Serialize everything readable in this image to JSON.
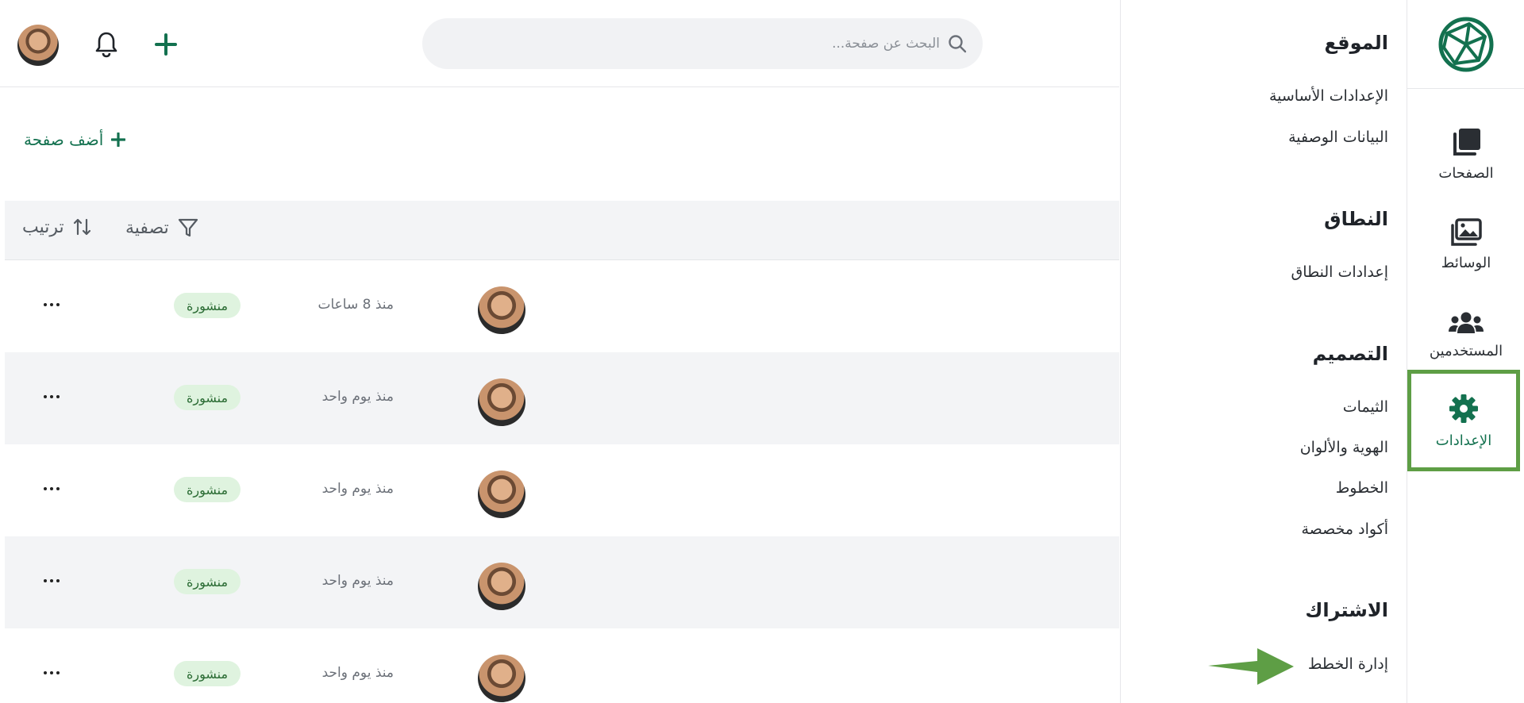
{
  "colors": {
    "brand": "#13714f",
    "active_outline": "#5e9e45",
    "arrow": "#5e9e45",
    "badge_bg": "#dff3df",
    "badge_text": "#2a6b33",
    "row_alt_bg": "#f3f4f6"
  },
  "rail": {
    "logo_icon": "brand-logo-icon",
    "items": [
      {
        "label": "الصفحات",
        "icon": "pages-icon"
      },
      {
        "label": "الوسائط",
        "icon": "media-icon"
      },
      {
        "label": "المستخدمين",
        "icon": "users-icon"
      },
      {
        "label": "الإعدادات",
        "icon": "gear-icon",
        "active": true
      }
    ]
  },
  "settings": {
    "sections": [
      {
        "title": "الموقع",
        "links": [
          "الإعدادات الأساسية",
          "البيانات الوصفية"
        ]
      },
      {
        "title": "النطاق",
        "links": [
          "إعدادات النطاق"
        ]
      },
      {
        "title": "التصميم",
        "links": [
          "الثيمات",
          "الهوية والألوان",
          "الخطوط",
          "أكواد مخصصة"
        ]
      },
      {
        "title": "الاشتراك",
        "links": [
          "إدارة الخطط"
        ]
      }
    ]
  },
  "header": {
    "search_placeholder": "البحث عن صفحة...",
    "icons": [
      "search-icon",
      "plus-icon",
      "bell-icon",
      "avatar"
    ]
  },
  "main": {
    "add_page_label": "أضف صفحة",
    "filter_label": "تصفية",
    "sort_label": "ترتيب",
    "rows": [
      {
        "time": "منذ 8 ساعات",
        "status": "منشورة"
      },
      {
        "time": "منذ يوم واحد",
        "status": "منشورة"
      },
      {
        "time": "منذ يوم واحد",
        "status": "منشورة"
      },
      {
        "time": "منذ يوم واحد",
        "status": "منشورة"
      },
      {
        "time": "منذ يوم واحد",
        "status": "منشورة"
      }
    ]
  }
}
